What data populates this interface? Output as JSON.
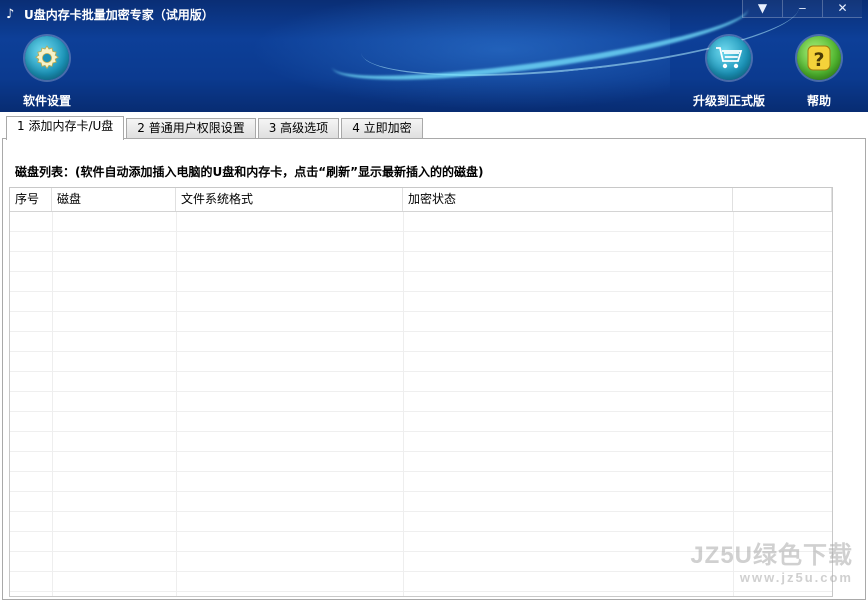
{
  "window": {
    "title": "U盘内存卡批量加密专家（试用版）",
    "controls": [
      "▼",
      "‒",
      "✕"
    ]
  },
  "toolbar": {
    "settings_label": "软件设置",
    "upgrade_label": "升级到正式版",
    "help_label": "帮助"
  },
  "tabs": [
    {
      "label": "1 添加内存卡/U盘"
    },
    {
      "label": "2 普通用户权限设置"
    },
    {
      "label": "3 高级选项"
    },
    {
      "label": "4 立即加密"
    }
  ],
  "disk_list": {
    "label": "磁盘列表：(软件自动添加插入电脑的U盘和内存卡，点击“刷新”显示最新插入的的磁盘)",
    "columns": [
      "序号",
      "磁盘",
      "文件系统格式",
      "加密状态",
      ""
    ]
  },
  "watermark": {
    "line1": "JZ5U绿色下载",
    "line2": "www.jz5u.com"
  },
  "colors": {
    "banner": "#0b3a8f",
    "accent": "#6fd9ee"
  },
  "icons": {
    "settings": "gear-icon",
    "upgrade": "cart-icon",
    "help": "question-icon"
  }
}
